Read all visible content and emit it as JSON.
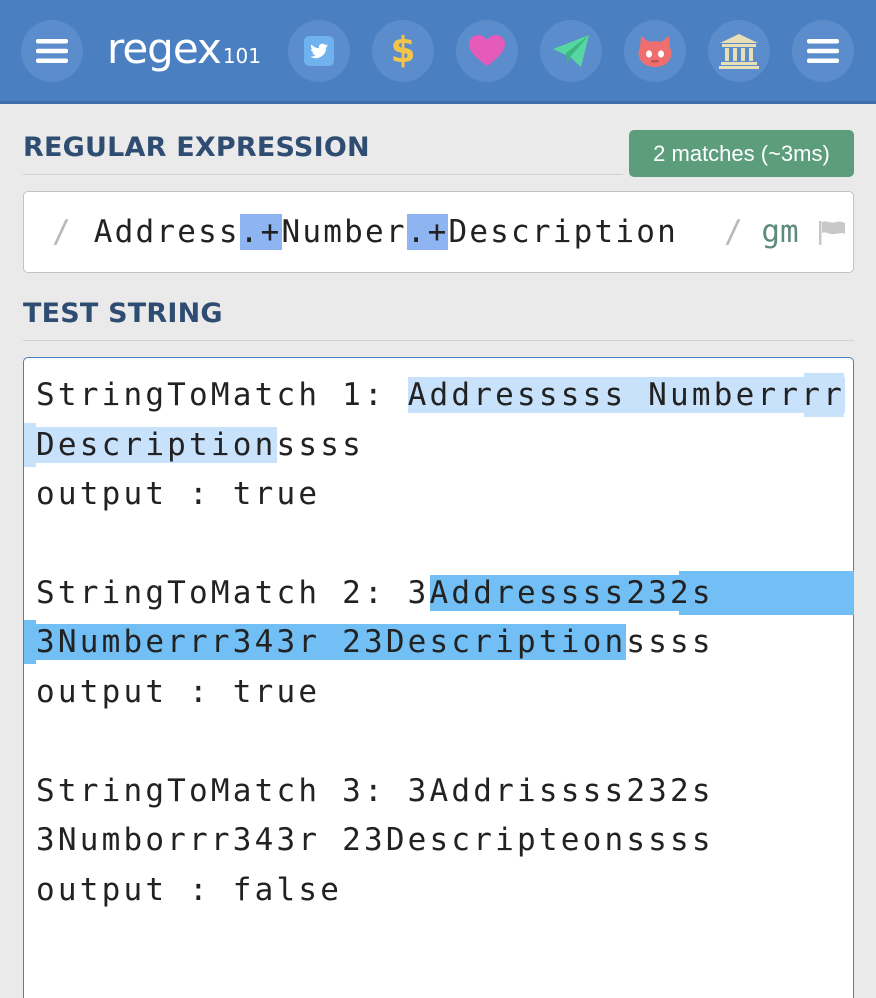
{
  "app": {
    "logo_main": "regex",
    "logo_num": "101"
  },
  "header_icons": [
    {
      "name": "menu-icon",
      "color": "#ffffff"
    },
    {
      "name": "twitter-icon",
      "color": "#6fb2ee"
    },
    {
      "name": "dollar-icon",
      "glyph": "$",
      "color": "#f3c54a"
    },
    {
      "name": "heart-icon",
      "color": "#e45bb9"
    },
    {
      "name": "paper-plane-icon",
      "color": "#56d6a0"
    },
    {
      "name": "github-icon",
      "color": "#ef6f6f"
    },
    {
      "name": "library-icon",
      "color": "#e9dfb4"
    },
    {
      "name": "menu-icon",
      "color": "#ffffff"
    }
  ],
  "regex_section": {
    "title": "REGULAR EXPRESSION",
    "match_badge": "2 matches (~3ms)",
    "delimiter_open": "/",
    "pattern_parts": [
      {
        "text": "Address",
        "token": false
      },
      {
        "text": ".+",
        "token": true
      },
      {
        "text": "Number",
        "token": false
      },
      {
        "text": ".+",
        "token": true
      },
      {
        "text": "Description",
        "token": false
      }
    ],
    "delimiter_close": "/",
    "flags": "gm"
  },
  "test_section": {
    "title": "TEST STRING",
    "lines": {
      "l1_prefix": "StringToMatch 1: ",
      "l1_match": "Addresssss Numberrrr",
      "l2_match": "Description",
      "l2_rest": "ssss",
      "l3": "output : true",
      "l5_prefix": "StringToMatch 2: 3",
      "l5_match": "Addressss232s",
      "l6_match": "3Numberrr343r 23Description",
      "l6_rest": "ssss",
      "l7": "output : true",
      "l9": "StringToMatch 3: 3Addrissss232s",
      "l10": "3Numborrr343r 23Descripteonssss",
      "l11": "output : false"
    }
  },
  "colors": {
    "header_bg": "#4a7fc1",
    "badge_bg": "#5c9e7c",
    "match_light": "#c9e2fb",
    "match_dark": "#72bff5",
    "token": "#8fb4f2"
  }
}
